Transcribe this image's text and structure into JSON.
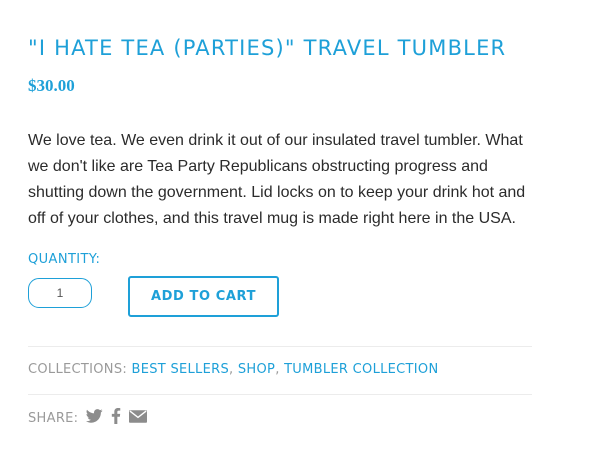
{
  "product": {
    "title": "\"I HATE TEA (PARTIES)\" TRAVEL TUMBLER",
    "price": "$30.00",
    "description_lines": [
      "We love tea. We even drink it out of our insulated travel tumbler. What",
      "we don't like are Tea Party Republicans obstructing progress and",
      "shutting down the government. Lid locks on to keep your drink hot and",
      "off of your clothes, and this travel mug is made right here in the USA."
    ]
  },
  "quantity": {
    "label": "QUANTITY:",
    "value": "1"
  },
  "cart": {
    "add_label": "ADD TO CART"
  },
  "collections": {
    "label": "COLLECTIONS: ",
    "items": [
      "BEST SELLERS",
      "SHOP",
      "TUMBLER COLLECTION"
    ],
    "separator": ", "
  },
  "share": {
    "label": "SHARE:",
    "icons": [
      "twitter-icon",
      "facebook-icon",
      "email-icon"
    ]
  },
  "colors": {
    "accent": "#1ea0d8",
    "muted": "#9a9a9a",
    "icon": "#8c8c8c",
    "body_text": "#2b2b2b"
  }
}
